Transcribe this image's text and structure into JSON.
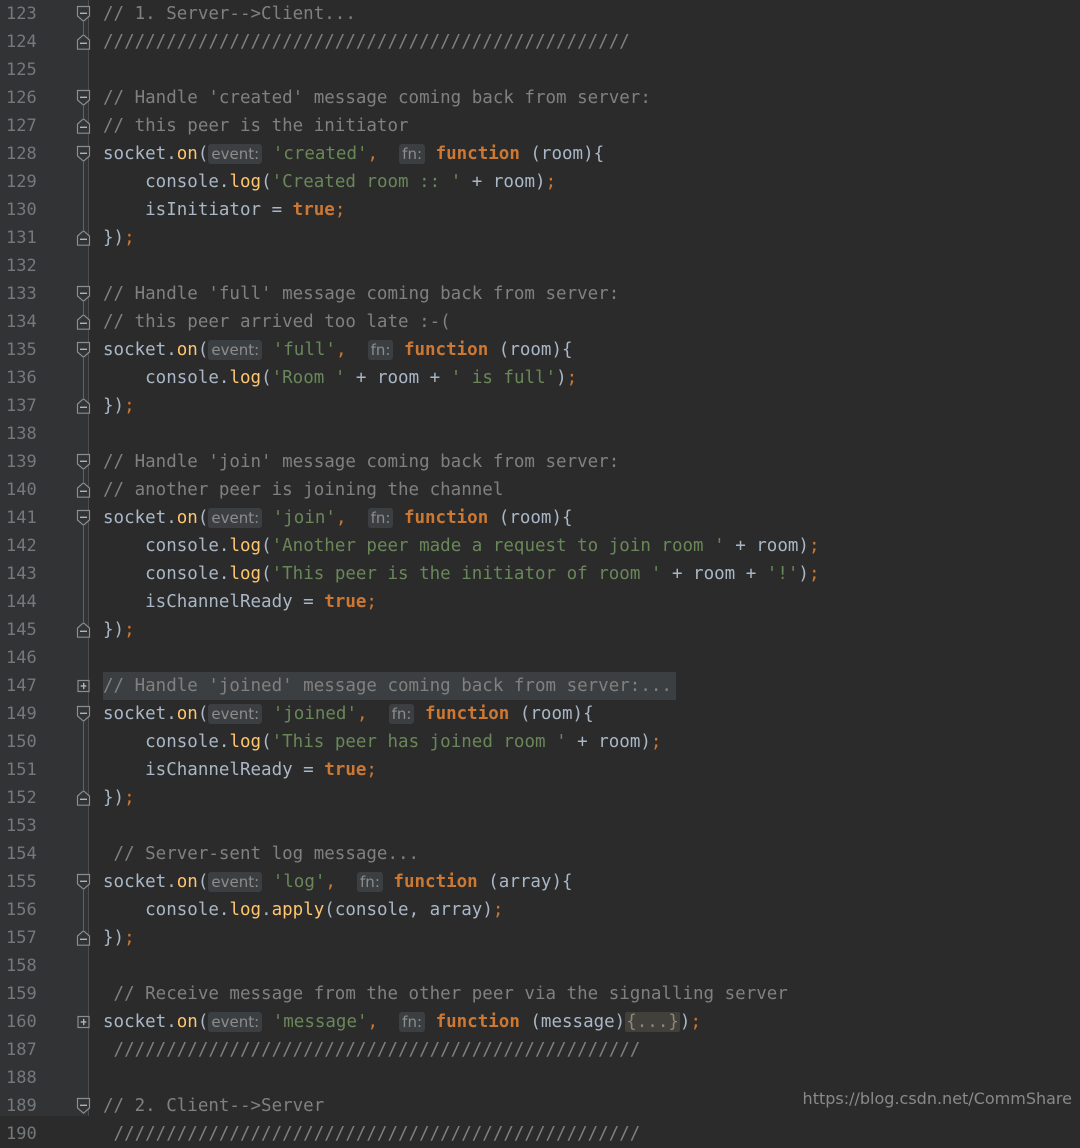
{
  "editor": {
    "theme_name": "darcula",
    "colors": {
      "background": "#2b2b2b",
      "gutter_background": "#313335",
      "default_text": "#a9b7c6",
      "comment": "#808080",
      "keyword": "#cc7832",
      "string": "#6a8759",
      "function": "#ffc66d",
      "line_number": "#75797c",
      "param_hint_bg": "#3c3f41",
      "fold_placeholder_bg": "#42403a",
      "folded_line_highlight": "#3c3f41"
    },
    "watermark": "https://blog.csdn.net/CommShare",
    "separator_comment": "//////////////////////////////////////////////////",
    "lines": [
      {
        "number": "123",
        "fold": "start",
        "tokens": [
          {
            "t": "// 1. Server-->Client...",
            "c": "cmt"
          }
        ]
      },
      {
        "number": "124",
        "fold": "end",
        "tokens": [
          {
            "t": "//////////////////////////////////////////////////",
            "c": "cmt"
          }
        ]
      },
      {
        "number": "125",
        "fold": "none",
        "tokens": []
      },
      {
        "number": "126",
        "fold": "start",
        "tokens": [
          {
            "t": "// Handle 'created' message coming back from server:",
            "c": "cmt"
          }
        ]
      },
      {
        "number": "127",
        "fold": "end",
        "tokens": [
          {
            "t": "// this peer is the initiator",
            "c": "cmt"
          }
        ]
      },
      {
        "number": "128",
        "fold": "start",
        "tokens": [
          {
            "t": "socket",
            "c": "ident"
          },
          {
            "t": ".",
            "c": "op"
          },
          {
            "t": "on",
            "c": "fn"
          },
          {
            "t": "(",
            "c": "op"
          },
          {
            "t": "event:",
            "c": "hint"
          },
          {
            "t": " ",
            "c": "op"
          },
          {
            "t": "'created'",
            "c": "str"
          },
          {
            "t": ",",
            "c": "semi"
          },
          {
            "t": "  ",
            "c": "op"
          },
          {
            "t": "fn:",
            "c": "hint"
          },
          {
            "t": " ",
            "c": "op"
          },
          {
            "t": "function",
            "c": "kw"
          },
          {
            "t": " (room){",
            "c": "op"
          }
        ]
      },
      {
        "number": "129",
        "fold": "none",
        "tokens": [
          {
            "t": "    console",
            "c": "ident"
          },
          {
            "t": ".",
            "c": "op"
          },
          {
            "t": "log",
            "c": "fn"
          },
          {
            "t": "(",
            "c": "op"
          },
          {
            "t": "'Created room :: '",
            "c": "str"
          },
          {
            "t": " + room)",
            "c": "op"
          },
          {
            "t": ";",
            "c": "semi"
          }
        ]
      },
      {
        "number": "130",
        "fold": "none",
        "tokens": [
          {
            "t": "    isInitiator = ",
            "c": "ident"
          },
          {
            "t": "true",
            "c": "kw"
          },
          {
            "t": ";",
            "c": "semi"
          }
        ]
      },
      {
        "number": "131",
        "fold": "end",
        "tokens": [
          {
            "t": "})",
            "c": "op"
          },
          {
            "t": ";",
            "c": "semi"
          }
        ]
      },
      {
        "number": "132",
        "fold": "none",
        "tokens": []
      },
      {
        "number": "133",
        "fold": "start",
        "tokens": [
          {
            "t": "// Handle 'full' message coming back from server:",
            "c": "cmt"
          }
        ]
      },
      {
        "number": "134",
        "fold": "end",
        "tokens": [
          {
            "t": "// this peer arrived too late :-(",
            "c": "cmt"
          }
        ]
      },
      {
        "number": "135",
        "fold": "start",
        "tokens": [
          {
            "t": "socket",
            "c": "ident"
          },
          {
            "t": ".",
            "c": "op"
          },
          {
            "t": "on",
            "c": "fn"
          },
          {
            "t": "(",
            "c": "op"
          },
          {
            "t": "event:",
            "c": "hint"
          },
          {
            "t": " ",
            "c": "op"
          },
          {
            "t": "'full'",
            "c": "str"
          },
          {
            "t": ",",
            "c": "semi"
          },
          {
            "t": "  ",
            "c": "op"
          },
          {
            "t": "fn:",
            "c": "hint"
          },
          {
            "t": " ",
            "c": "op"
          },
          {
            "t": "function",
            "c": "kw"
          },
          {
            "t": " (room){",
            "c": "op"
          }
        ]
      },
      {
        "number": "136",
        "fold": "none",
        "tokens": [
          {
            "t": "    console",
            "c": "ident"
          },
          {
            "t": ".",
            "c": "op"
          },
          {
            "t": "log",
            "c": "fn"
          },
          {
            "t": "(",
            "c": "op"
          },
          {
            "t": "'Room '",
            "c": "str"
          },
          {
            "t": " + room + ",
            "c": "op"
          },
          {
            "t": "' is full'",
            "c": "str"
          },
          {
            "t": ")",
            "c": "op"
          },
          {
            "t": ";",
            "c": "semi"
          }
        ]
      },
      {
        "number": "137",
        "fold": "end",
        "tokens": [
          {
            "t": "})",
            "c": "op"
          },
          {
            "t": ";",
            "c": "semi"
          }
        ]
      },
      {
        "number": "138",
        "fold": "none",
        "tokens": []
      },
      {
        "number": "139",
        "fold": "start",
        "tokens": [
          {
            "t": "// Handle 'join' message coming back from server:",
            "c": "cmt"
          }
        ]
      },
      {
        "number": "140",
        "fold": "end",
        "tokens": [
          {
            "t": "// another peer is joining the channel",
            "c": "cmt"
          }
        ]
      },
      {
        "number": "141",
        "fold": "start",
        "tokens": [
          {
            "t": "socket",
            "c": "ident"
          },
          {
            "t": ".",
            "c": "op"
          },
          {
            "t": "on",
            "c": "fn"
          },
          {
            "t": "(",
            "c": "op"
          },
          {
            "t": "event:",
            "c": "hint"
          },
          {
            "t": " ",
            "c": "op"
          },
          {
            "t": "'join'",
            "c": "str"
          },
          {
            "t": ",",
            "c": "semi"
          },
          {
            "t": "  ",
            "c": "op"
          },
          {
            "t": "fn:",
            "c": "hint"
          },
          {
            "t": " ",
            "c": "op"
          },
          {
            "t": "function",
            "c": "kw"
          },
          {
            "t": " (room){",
            "c": "op"
          }
        ]
      },
      {
        "number": "142",
        "fold": "none",
        "tokens": [
          {
            "t": "    console",
            "c": "ident"
          },
          {
            "t": ".",
            "c": "op"
          },
          {
            "t": "log",
            "c": "fn"
          },
          {
            "t": "(",
            "c": "op"
          },
          {
            "t": "'Another peer made a request to join room '",
            "c": "str"
          },
          {
            "t": " + room)",
            "c": "op"
          },
          {
            "t": ";",
            "c": "semi"
          }
        ]
      },
      {
        "number": "143",
        "fold": "none",
        "tokens": [
          {
            "t": "    console",
            "c": "ident"
          },
          {
            "t": ".",
            "c": "op"
          },
          {
            "t": "log",
            "c": "fn"
          },
          {
            "t": "(",
            "c": "op"
          },
          {
            "t": "'This peer is the initiator of room '",
            "c": "str"
          },
          {
            "t": " + room + ",
            "c": "op"
          },
          {
            "t": "'!'",
            "c": "str"
          },
          {
            "t": ")",
            "c": "op"
          },
          {
            "t": ";",
            "c": "semi"
          }
        ]
      },
      {
        "number": "144",
        "fold": "none",
        "tokens": [
          {
            "t": "    isChannelReady = ",
            "c": "ident"
          },
          {
            "t": "true",
            "c": "kw"
          },
          {
            "t": ";",
            "c": "semi"
          }
        ]
      },
      {
        "number": "145",
        "fold": "end",
        "tokens": [
          {
            "t": "})",
            "c": "op"
          },
          {
            "t": ";",
            "c": "semi"
          }
        ]
      },
      {
        "number": "146",
        "fold": "none",
        "tokens": []
      },
      {
        "number": "147",
        "fold": "collapsed",
        "row_highlight": true,
        "tokens": [
          {
            "t": "// Handle 'joined' message coming back from server:...",
            "c": "cmt"
          }
        ]
      },
      {
        "number": "149",
        "fold": "start",
        "tokens": [
          {
            "t": "socket",
            "c": "ident"
          },
          {
            "t": ".",
            "c": "op"
          },
          {
            "t": "on",
            "c": "fn"
          },
          {
            "t": "(",
            "c": "op"
          },
          {
            "t": "event:",
            "c": "hint"
          },
          {
            "t": " ",
            "c": "op"
          },
          {
            "t": "'joined'",
            "c": "str"
          },
          {
            "t": ",",
            "c": "semi"
          },
          {
            "t": "  ",
            "c": "op"
          },
          {
            "t": "fn:",
            "c": "hint"
          },
          {
            "t": " ",
            "c": "op"
          },
          {
            "t": "function",
            "c": "kw"
          },
          {
            "t": " (room){",
            "c": "op"
          }
        ]
      },
      {
        "number": "150",
        "fold": "none",
        "tokens": [
          {
            "t": "    console",
            "c": "ident"
          },
          {
            "t": ".",
            "c": "op"
          },
          {
            "t": "log",
            "c": "fn"
          },
          {
            "t": "(",
            "c": "op"
          },
          {
            "t": "'This peer has joined room '",
            "c": "str"
          },
          {
            "t": " + room)",
            "c": "op"
          },
          {
            "t": ";",
            "c": "semi"
          }
        ]
      },
      {
        "number": "151",
        "fold": "none",
        "tokens": [
          {
            "t": "    isChannelReady = ",
            "c": "ident"
          },
          {
            "t": "true",
            "c": "kw"
          },
          {
            "t": ";",
            "c": "semi"
          }
        ]
      },
      {
        "number": "152",
        "fold": "end",
        "tokens": [
          {
            "t": "})",
            "c": "op"
          },
          {
            "t": ";",
            "c": "semi"
          }
        ]
      },
      {
        "number": "153",
        "fold": "none",
        "tokens": []
      },
      {
        "number": "154",
        "fold": "none",
        "tokens": [
          {
            "t": " // Server-sent log message...",
            "c": "cmt"
          }
        ]
      },
      {
        "number": "155",
        "fold": "start",
        "tokens": [
          {
            "t": "socket",
            "c": "ident"
          },
          {
            "t": ".",
            "c": "op"
          },
          {
            "t": "on",
            "c": "fn"
          },
          {
            "t": "(",
            "c": "op"
          },
          {
            "t": "event:",
            "c": "hint"
          },
          {
            "t": " ",
            "c": "op"
          },
          {
            "t": "'log'",
            "c": "str"
          },
          {
            "t": ",",
            "c": "semi"
          },
          {
            "t": "  ",
            "c": "op"
          },
          {
            "t": "fn:",
            "c": "hint"
          },
          {
            "t": " ",
            "c": "op"
          },
          {
            "t": "function",
            "c": "kw"
          },
          {
            "t": " (array){",
            "c": "op"
          }
        ]
      },
      {
        "number": "156",
        "fold": "none",
        "tokens": [
          {
            "t": "    console",
            "c": "ident"
          },
          {
            "t": ".",
            "c": "op"
          },
          {
            "t": "log",
            "c": "fn"
          },
          {
            "t": ".",
            "c": "op"
          },
          {
            "t": "apply",
            "c": "fn"
          },
          {
            "t": "(console, array)",
            "c": "op"
          },
          {
            "t": ";",
            "c": "semi"
          }
        ]
      },
      {
        "number": "157",
        "fold": "end",
        "tokens": [
          {
            "t": "})",
            "c": "op"
          },
          {
            "t": ";",
            "c": "semi"
          }
        ]
      },
      {
        "number": "158",
        "fold": "none",
        "tokens": []
      },
      {
        "number": "159",
        "fold": "none",
        "tokens": [
          {
            "t": " // Receive message from the other peer via the signalling server",
            "c": "cmt"
          }
        ]
      },
      {
        "number": "160",
        "fold": "collapsed",
        "tokens": [
          {
            "t": "socket",
            "c": "ident"
          },
          {
            "t": ".",
            "c": "op"
          },
          {
            "t": "on",
            "c": "fn"
          },
          {
            "t": "(",
            "c": "op"
          },
          {
            "t": "event:",
            "c": "hint"
          },
          {
            "t": " ",
            "c": "op"
          },
          {
            "t": "'message'",
            "c": "str"
          },
          {
            "t": ",",
            "c": "semi"
          },
          {
            "t": "  ",
            "c": "op"
          },
          {
            "t": "fn:",
            "c": "hint"
          },
          {
            "t": " ",
            "c": "op"
          },
          {
            "t": "function",
            "c": "kw"
          },
          {
            "t": " (message)",
            "c": "op"
          },
          {
            "t": "{...}",
            "c": "foldph"
          },
          {
            "t": ")",
            "c": "op"
          },
          {
            "t": ";",
            "c": "semi"
          }
        ]
      },
      {
        "number": "187",
        "fold": "none",
        "tokens": [
          {
            "t": " //////////////////////////////////////////////////",
            "c": "cmt"
          }
        ]
      },
      {
        "number": "188",
        "fold": "none",
        "tokens": []
      },
      {
        "number": "189",
        "fold": "start",
        "tokens": [
          {
            "t": "// 2. Client-->Server",
            "c": "cmt"
          }
        ]
      },
      {
        "number": "190",
        "fold": "none",
        "tokens": [
          {
            "t": " //////////////////////////////////////////////////",
            "c": "cmt"
          }
        ]
      }
    ]
  }
}
